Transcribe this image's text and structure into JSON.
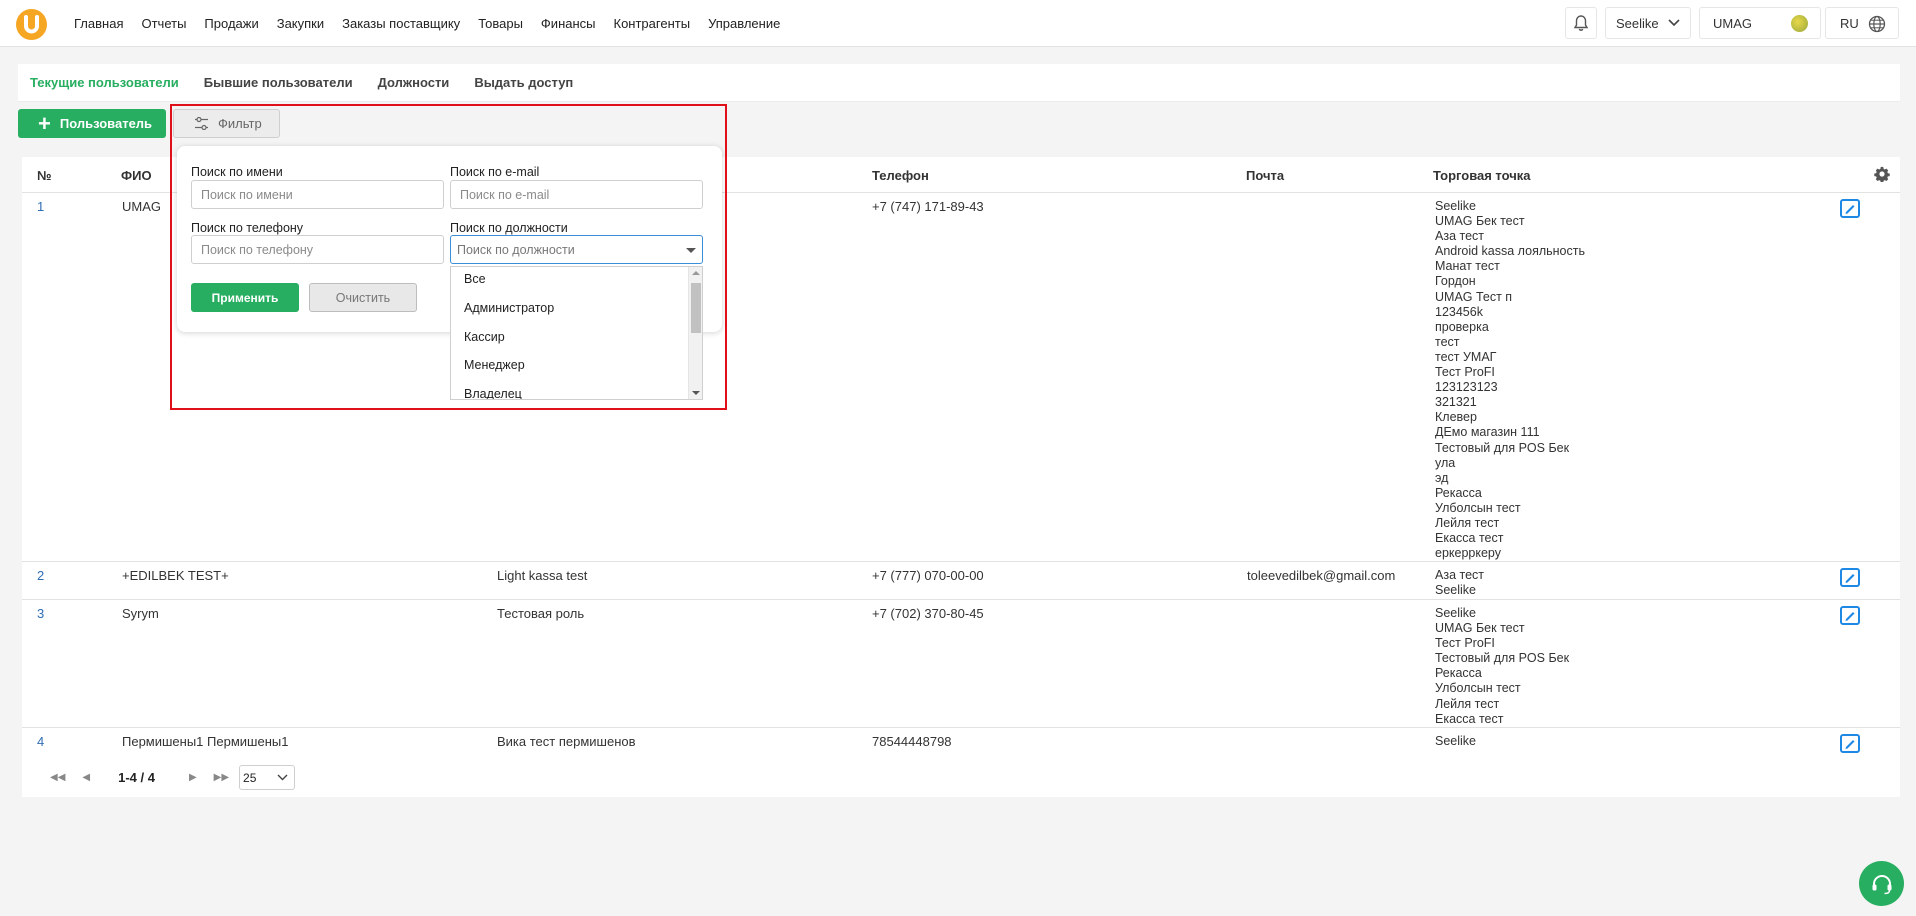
{
  "nav": {
    "items": [
      "Главная",
      "Отчеты",
      "Продажи",
      "Закупки",
      "Заказы поставщику",
      "Товары",
      "Финансы",
      "Контрагенты",
      "Управление"
    ],
    "store": "Seelike",
    "user": "UMAG",
    "lang": "RU"
  },
  "tabs": [
    "Текущие пользователи",
    "Бывшие пользователи",
    "Должности",
    "Выдать доступ"
  ],
  "actions": {
    "add_user": "Пользователь",
    "filter": "Фильтр"
  },
  "filter": {
    "name_label": "Поиск по имени",
    "name_placeholder": "Поиск по имени",
    "email_label": "Поиск по e-mail",
    "email_placeholder": "Поиск по e-mail",
    "phone_label": "Поиск по телефону",
    "phone_placeholder": "Поиск по телефону",
    "role_label": "Поиск по должности",
    "role_placeholder": "Поиск по должности",
    "apply": "Применить",
    "clear": "Очистить",
    "role_options": [
      "Все",
      "Администратор",
      "Кассир",
      "Менеджер",
      "Владелец"
    ]
  },
  "table": {
    "headers": {
      "num": "№",
      "fio": "ФИО",
      "phone": "Телефон",
      "email": "Почта",
      "store": "Торговая точка"
    },
    "rows": [
      {
        "num": "1",
        "fio": "UMAG",
        "role": "",
        "phone": "+7 (747) 171-89-43",
        "email": "",
        "stores": [
          "Seelike",
          "UMAG Бек тест",
          "Аза тест",
          "Android kassa лояльность",
          "Манат тест",
          "Гордон",
          "UMAG Тест п",
          "123456k",
          "проверка",
          "тест",
          "тест УМАГ",
          "Тест ProFI",
          "123123123",
          "321321",
          "Клевер",
          "ДЕмо магазин 111",
          "Тестовый для POS Бек",
          "ула",
          "эд",
          "Рекасса",
          "Улболсын тест",
          "Лейля тест",
          "Екасса тест",
          "еркерркеру"
        ]
      },
      {
        "num": "2",
        "fio": "+EDILBEK TEST+",
        "role": "Light kassa test",
        "phone": "+7 (777) 070-00-00",
        "email": "toleevedilbek@gmail.com",
        "stores": [
          "Аза тест",
          "Seelike"
        ]
      },
      {
        "num": "3",
        "fio": "Syrym",
        "role": "Тестовая роль",
        "phone": "+7 (702) 370-80-45",
        "email": "",
        "stores": [
          "Seelike",
          "UMAG Бек тест",
          "Тест ProFI",
          "Тестовый для POS Бек",
          "Рекасса",
          "Улболсын тест",
          "Лейля тест",
          "Екасса тест"
        ]
      },
      {
        "num": "4",
        "fio": "Пермишены1 Пермишены1",
        "role": "Вика тест пермишенов",
        "phone": "78544448798",
        "email": "",
        "stores": [
          "Seelike"
        ]
      }
    ]
  },
  "pager": {
    "info": "1-4 / 4",
    "page_size": "25"
  },
  "colors": {
    "accent": "#27ae60",
    "highlight": "#e0101a",
    "link": "#2f6db5",
    "edit": "#1e88e5"
  },
  "icons": [
    "bell-icon",
    "chevron-down-icon",
    "globe-icon",
    "plus-icon",
    "sliders-icon",
    "gear-icon",
    "edit-icon",
    "headset-icon"
  ]
}
